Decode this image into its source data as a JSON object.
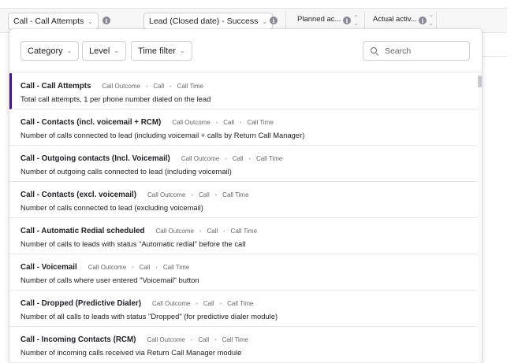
{
  "header": {
    "metric_selector": "Call - Call Attempts",
    "goal_selector": "Lead (Closed date) - Success",
    "col_planned": "Planned ac...",
    "col_actual": "Actual activ..."
  },
  "filters": {
    "category": "Category",
    "level": "Level",
    "time_filter": "Time filter",
    "search_placeholder": "Search"
  },
  "icons": {
    "info": "info-icon",
    "sort": "sort-icon",
    "search": "search-icon",
    "chevron": "chevron-down-icon"
  },
  "colors": {
    "selected_accent": "#3b1f7a"
  },
  "metrics": [
    {
      "title": "Call - Call Attempts",
      "tags": [
        "Call Outcome",
        "Call",
        "Call Time"
      ],
      "description": "Total call attempts, 1 per phone number dialed on the lead",
      "selected": true
    },
    {
      "title": "Call - Contacts (incl. voicemail + RCM)",
      "tags": [
        "Call Outcome",
        "Call",
        "Call Time"
      ],
      "description": "Number of calls connected to lead (including voicemail + calls by Return Call Manager)"
    },
    {
      "title": "Call - Outgoing contacts (Incl. Voicemail)",
      "tags": [
        "Call Outcome",
        "Call",
        "Call Time"
      ],
      "description": "Number of outgoing calls connected to lead (including voicemail)"
    },
    {
      "title": "Call - Contacts (excl. voicemail)",
      "tags": [
        "Call Outcome",
        "Call",
        "Call Time"
      ],
      "description": "Number of calls connected to lead (excluding voicemail)"
    },
    {
      "title": "Call - Automatic Redial scheduled",
      "tags": [
        "Call Outcome",
        "Call",
        "Call Time"
      ],
      "description": "Number of calls to leads with status \"Automatic redial\" before the call"
    },
    {
      "title": "Call - Voicemail",
      "tags": [
        "Call Outcome",
        "Call",
        "Call Time"
      ],
      "description": "Number of calls where user entered \"Voicemail\" button"
    },
    {
      "title": "Call - Dropped (Predictive Dialer)",
      "tags": [
        "Call Outcome",
        "Call",
        "Call Time"
      ],
      "description": "Number of all calls to leads with status \"Dropped\" (for predictive dialer module)"
    },
    {
      "title": "Call - Incoming Contacts (RCM)",
      "tags": [
        "Call Outcome",
        "Call",
        "Call Time"
      ],
      "description": "Number of incoming calls received via Return Call Manager module"
    }
  ]
}
